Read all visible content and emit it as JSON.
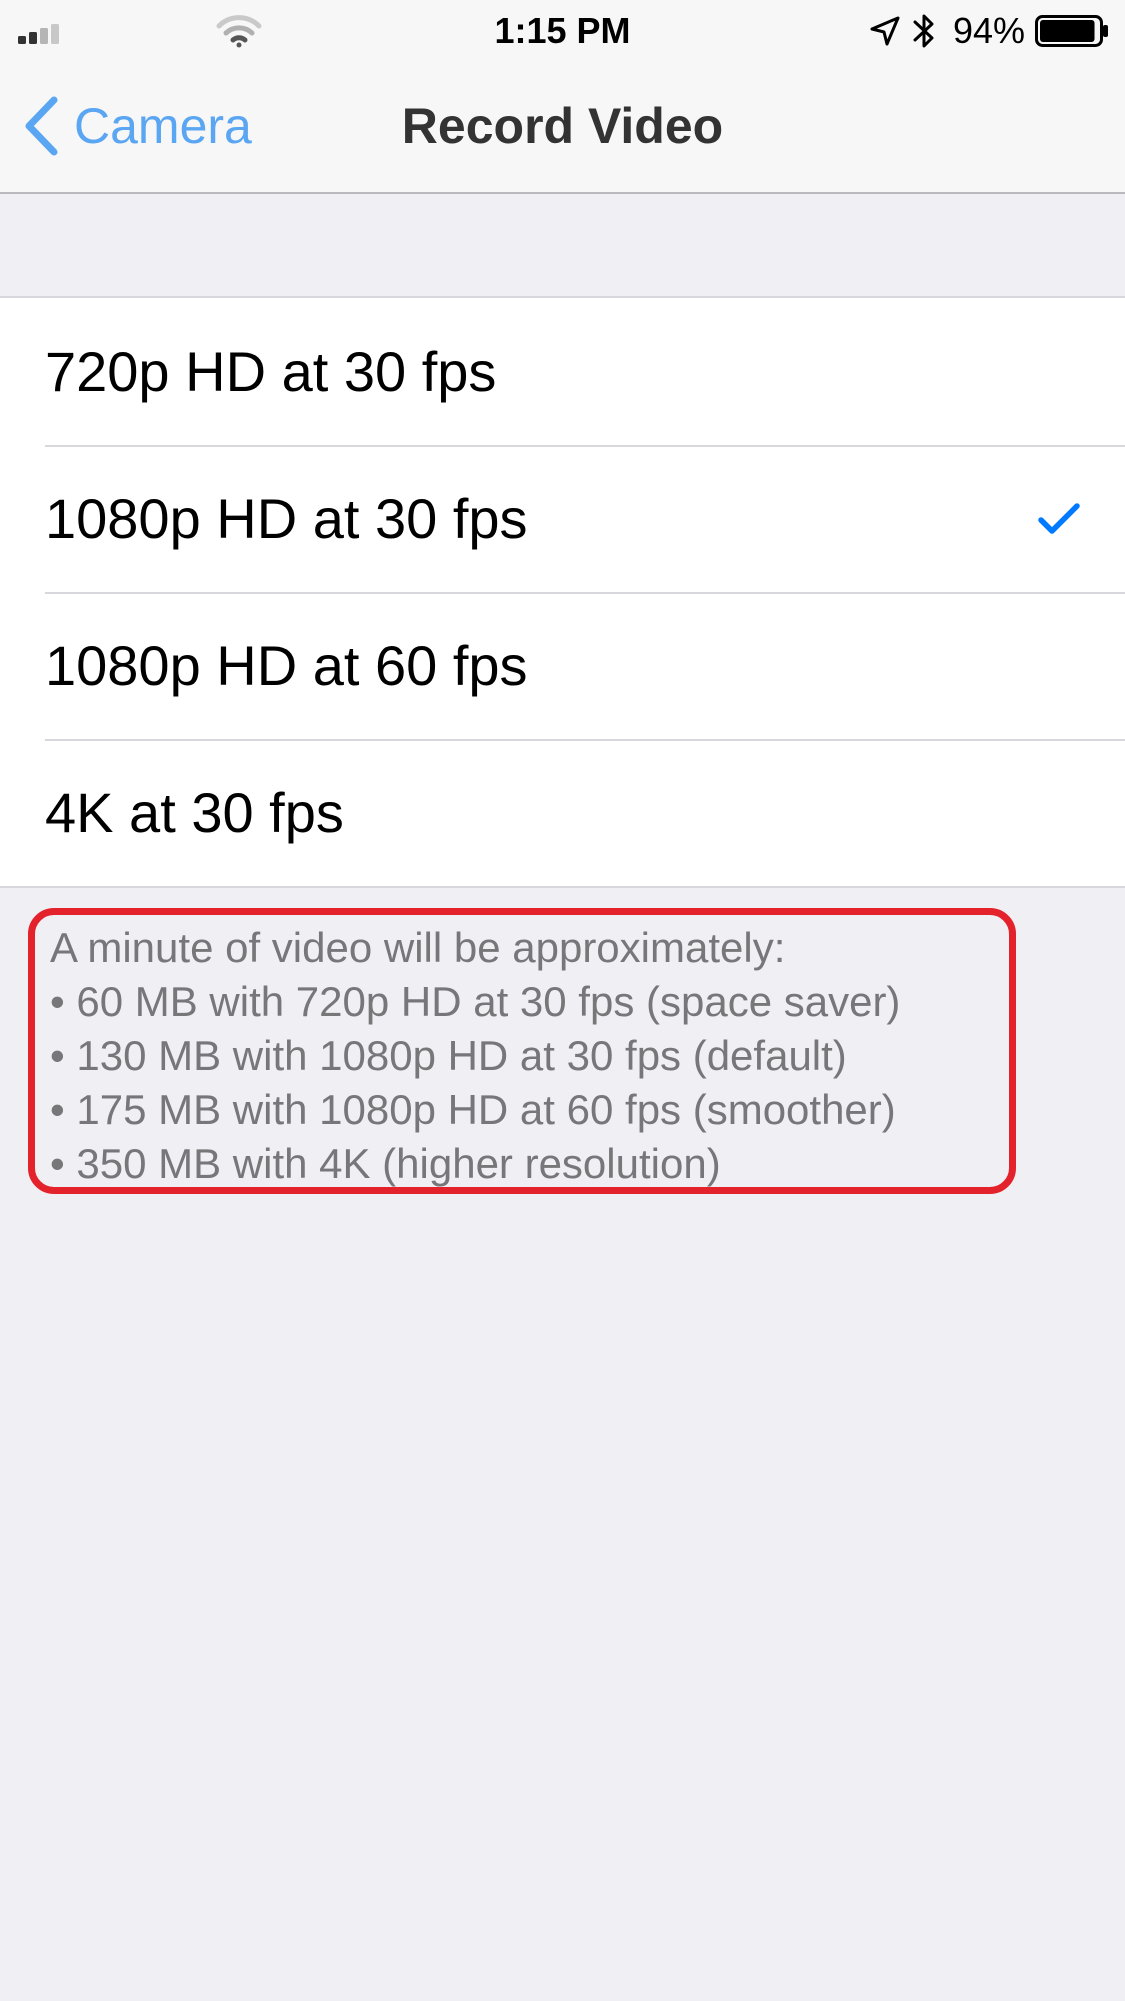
{
  "status_bar": {
    "time": "1:15 PM",
    "battery_percent": "94%",
    "battery_level": 0.94
  },
  "nav": {
    "back_label": "Camera",
    "title": "Record Video"
  },
  "options": [
    {
      "label": "720p HD at 30 fps",
      "selected": false
    },
    {
      "label": "1080p HD at 30 fps",
      "selected": true
    },
    {
      "label": "1080p HD at 60 fps",
      "selected": false
    },
    {
      "label": "4K at 30 fps",
      "selected": false
    }
  ],
  "footer": {
    "heading": "A minute of video will be approximately:",
    "items": [
      "• 60 MB with 720p HD at 30 fps (space saver)",
      "• 130 MB with 1080p HD at 30 fps (default)",
      "• 175 MB with 1080p HD at 60 fps (smoother)",
      "• 350 MB with 4K (higher resolution)"
    ],
    "highlight_color": "#e3222c"
  },
  "colors": {
    "accent": "#007aff",
    "back_link": "#5aa6f2",
    "background": "#efeff4"
  },
  "icons": [
    "cellular-signal-icon",
    "wifi-icon",
    "location-arrow-icon",
    "bluetooth-icon",
    "battery-icon",
    "chevron-left-icon",
    "checkmark-icon"
  ]
}
